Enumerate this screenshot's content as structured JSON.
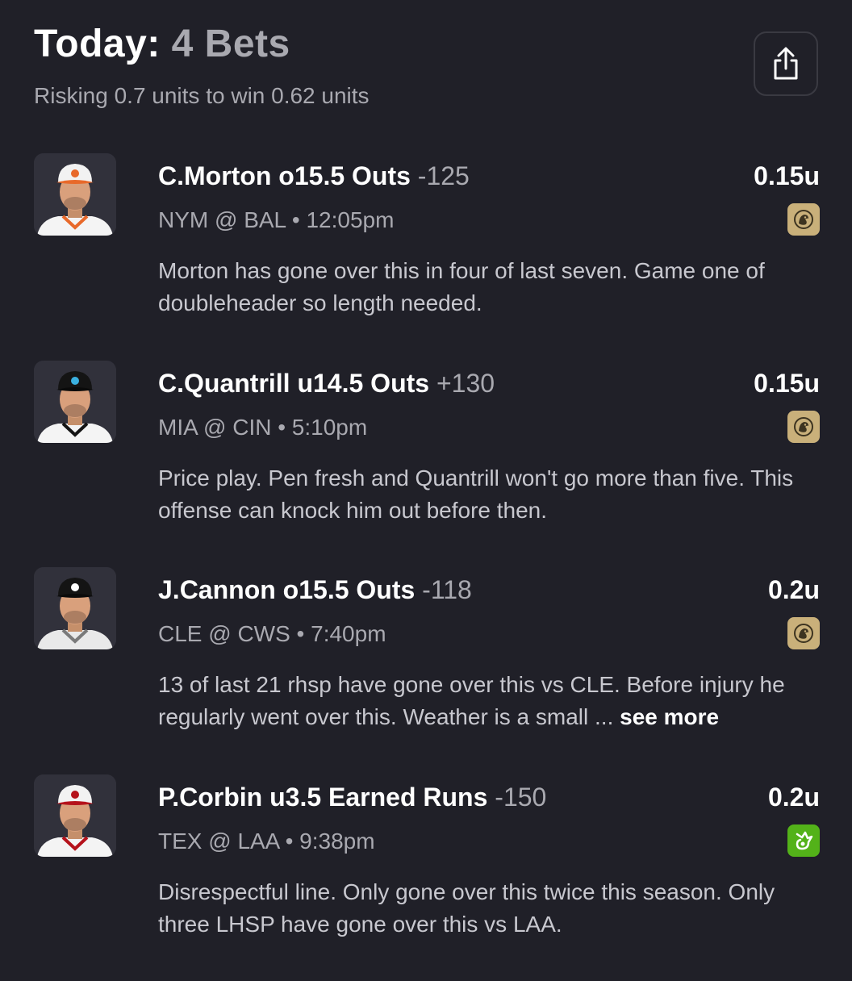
{
  "header": {
    "title_prefix": "Today:",
    "title_count": "4 Bets",
    "subtitle": "Risking 0.7 units to win 0.62 units",
    "share_icon": "share-icon"
  },
  "bets": [
    {
      "player_line": "C.Morton o15.5 Outs",
      "odds": "-125",
      "units": "0.15u",
      "game": "NYM @ BAL • 12:05pm",
      "note": "Morton has gone over this in four of last seven. Game one of doubleheader so length needed.",
      "see_more": "",
      "sportsbook_icon": "betmgm-icon",
      "cap_color": "#f2f2f2",
      "cap_accent": "#e8692a",
      "jersey_color": "#f4f4f4",
      "jersey_trim": "#e8692a"
    },
    {
      "player_line": "C.Quantrill u14.5 Outs",
      "odds": "+130",
      "units": "0.15u",
      "game": "MIA @ CIN • 5:10pm",
      "note": "Price play. Pen fresh and Quantrill won't go more than five. This offense can knock him out before then.",
      "see_more": "",
      "sportsbook_icon": "betmgm-icon",
      "cap_color": "#141414",
      "cap_accent": "#3ab0e0",
      "jersey_color": "#f4f4f4",
      "jersey_trim": "#141414"
    },
    {
      "player_line": "J.Cannon o15.5 Outs",
      "odds": "-118",
      "units": "0.2u",
      "game": "CLE @ CWS • 7:40pm",
      "note": "13 of last 21 rhsp have gone over this vs CLE. Before injury he regularly went over this. Weather is a small ...",
      "see_more": "see more",
      "sportsbook_icon": "betmgm-icon",
      "cap_color": "#141414",
      "cap_accent": "#ffffff",
      "jersey_color": "#e9e9e9",
      "jersey_trim": "#7a7a7a"
    },
    {
      "player_line": "P.Corbin u3.5 Earned Runs",
      "odds": "-150",
      "units": "0.2u",
      "game": "TEX @ LAA • 9:38pm",
      "note": "Disrespectful line. Only gone over this twice this season. Only three LHSP have gone over this vs LAA.",
      "see_more": "",
      "sportsbook_icon": "draftkings-icon",
      "cap_color": "#f2f2f2",
      "cap_accent": "#b5121b",
      "jersey_color": "#f4f4f4",
      "jersey_trim": "#b5121b"
    }
  ],
  "colors": {
    "background": "#202028",
    "muted_text": "#a9a9b0",
    "betmgm_gold": "#c9b07a",
    "draftkings_green": "#53b219"
  }
}
